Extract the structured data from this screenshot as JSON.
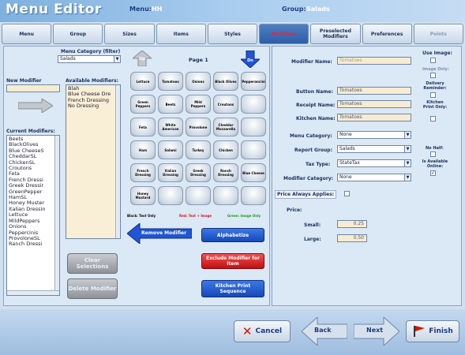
{
  "header": {
    "title": "Menu Editor",
    "menu_label": "Menu:",
    "menu_value": "HH",
    "group_label": "Group:",
    "group_value": "Salads"
  },
  "tabs": [
    {
      "label": "Menu"
    },
    {
      "label": "Group"
    },
    {
      "label": "Sizes"
    },
    {
      "label": "Items"
    },
    {
      "label": "Styles"
    },
    {
      "label": "Modifiers"
    },
    {
      "label": "Preselected Modifiers"
    },
    {
      "label": "Preferences"
    },
    {
      "label": "Points"
    }
  ],
  "left": {
    "menu_category_label": "Menu Category (filter)",
    "menu_category_value": "Salads",
    "new_modifier_label": "New Modifier",
    "available_label": "Available Modifiers:",
    "available_items": [
      "Blah",
      "Blue Cheese Dre",
      "French Dressing",
      "No Dressing"
    ],
    "current_label": "Current Modifiers:",
    "current_items": [
      "Beets",
      "BlackOlives",
      "Blue CheeseS",
      "CheddarSL",
      "ChickenSL",
      "Croutons",
      "Feta",
      "French Dressi",
      "Greek Dressir",
      "GreenPepper",
      "HamSL",
      "Honey Muster",
      "Italian Dressin",
      "Lettuce",
      "MildPeppers",
      "Onions",
      "Peppercinis",
      "ProvoloneSL",
      "Ranch Dressi"
    ],
    "page_label": "Page 1",
    "up_label": "Up",
    "down_label": "Dn",
    "keys": [
      [
        "Lettuce",
        "Tomatoes",
        "Onions",
        "Black Olives",
        "Pepperoncini"
      ],
      [
        "Green Peppers",
        "Beets",
        "Mild Peppers",
        "Croutons",
        ""
      ],
      [
        "Feta",
        "White American",
        "Provolone",
        "Cheddar Mozzarella",
        ""
      ],
      [
        "Ham",
        "Salami",
        "Turkey",
        "Chicken",
        ""
      ],
      [
        "French Dressing",
        "Italian Dressing",
        "Greek Dressing",
        "Ranch Dressing",
        "Blue Cheese"
      ],
      [
        "Honey Mustard",
        "",
        "",
        "",
        ""
      ]
    ],
    "legend_black": "Black: Text Only",
    "legend_red": "Red: Text + Image",
    "legend_green": "Green: Image Only",
    "remove_label": "Remove Modifier",
    "alphabetize_label": "Alphabetize",
    "exclude_label": "Exclude Modifier for Item",
    "kitchen_seq_label": "Kitchen Print Sequence",
    "clear_label": "Clear Selections",
    "delete_label": "Delete Modifier"
  },
  "right": {
    "modifier_name_label": "Modifier Name:",
    "modifier_name_value": "Tomatoes",
    "button_name_label": "Button Name:",
    "button_name_value": "Tomatoes",
    "receipt_name_label": "Receipt Name:",
    "receipt_name_value": "Tomatoes",
    "kitchen_name_label": "Kitchen Name:",
    "kitchen_name_value": "Tomatoes",
    "menu_category_label": "Menu Category:",
    "menu_category_value": "None",
    "report_group_label": "Report Group:",
    "report_group_value": "Salads",
    "tax_type_label": "Tax Type:",
    "tax_type_value": "StateTax",
    "modifier_category_label": "Modifier Category:",
    "modifier_category_value": "None",
    "price_always_label": "Price Always Applies:",
    "price_label": "Price:",
    "small_label": "Small:",
    "small_value": "0.25",
    "large_label": "Large:",
    "large_value": "0.50",
    "use_image_label": "Use Image:",
    "image_only_label": "Image Only:",
    "delivery_label": "Delivery Reminder:",
    "kitchen_print_label": "Kitchen Print Only:",
    "no_half_label": "No Half:",
    "available_online_label": "Is Available Online:",
    "check_mark": "✓"
  },
  "footer": {
    "cancel_label": "Cancel",
    "back_label": "Back",
    "next_label": "Next",
    "finish_label": "Finish",
    "cancel_icon": "✕"
  },
  "colors": {
    "accent_blue": "#1748b8",
    "danger_red": "#c01010",
    "tan_field": "#f7ecd2"
  }
}
